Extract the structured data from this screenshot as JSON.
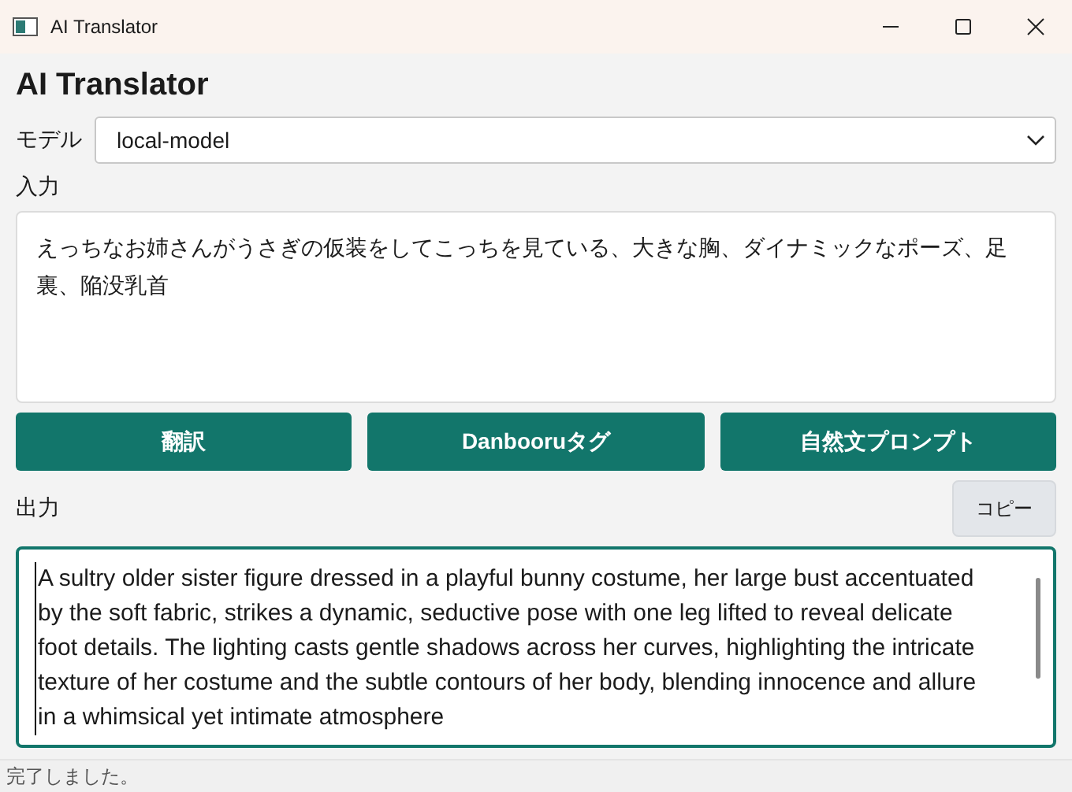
{
  "window": {
    "title": "AI Translator"
  },
  "heading": "AI Translator",
  "model": {
    "label": "モデル",
    "value": "local-model"
  },
  "input": {
    "label": "入力",
    "value": "えっちなお姉さんがうさぎの仮装をしてこっちを見ている、大きな胸、ダイナミックなポーズ、足裏、陥没乳首"
  },
  "buttons": [
    "翻訳",
    "Danbooruタグ",
    "自然文プロンプト"
  ],
  "output": {
    "label": "出力",
    "copy_button": "コピー",
    "value": "A sultry older sister figure dressed in a playful bunny costume, her large bust accentuated by the soft fabric, strikes a dynamic, seductive pose with one leg lifted to reveal delicate foot details. The lighting casts gentle shadows across her curves, highlighting the intricate texture of her costume and the subtle contours of her body, blending innocence and allure in a whimsical yet intimate atmosphere"
  },
  "status_bar": "完了しました。"
}
